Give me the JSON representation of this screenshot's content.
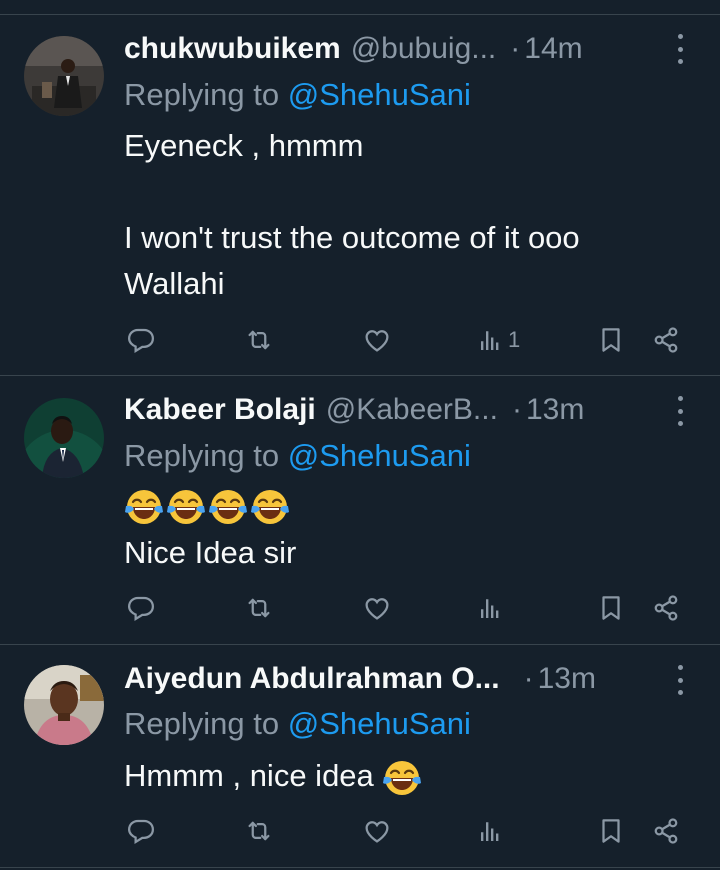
{
  "tweets": [
    {
      "name": "chukwubuikem",
      "handle": "@bubuig...",
      "time": "14m",
      "reply_prefix": "Replying to ",
      "reply_to": "@ShehuSani",
      "lines": [
        "Eyeneck , hmmm",
        "",
        "I won't trust the outcome of it ooo",
        "Wallahi"
      ],
      "views": "1"
    },
    {
      "name": "Kabeer Bolaji",
      "handle": "@KabeerB...",
      "time": "13m",
      "reply_prefix": "Replying to ",
      "reply_to": "@ShehuSani",
      "emoji_count": 4,
      "lines": [
        "Nice Idea  sir"
      ],
      "views": ""
    },
    {
      "name": "Aiyedun Abdulrahman O...",
      "handle": "",
      "time": "13m",
      "reply_prefix": "Replying to ",
      "reply_to": "@ShehuSani",
      "lines": [
        "Hmmm , nice idea"
      ],
      "views": ""
    }
  ],
  "dot": "·",
  "icons": [
    "reply-icon",
    "retweet-icon",
    "like-icon",
    "views-icon",
    "bookmark-icon",
    "share-icon"
  ],
  "colors": {
    "background": "#15202b",
    "text": "#f7f9f9",
    "muted": "#8b98a5",
    "link": "#1d9bf0",
    "divider": "#38444d"
  }
}
